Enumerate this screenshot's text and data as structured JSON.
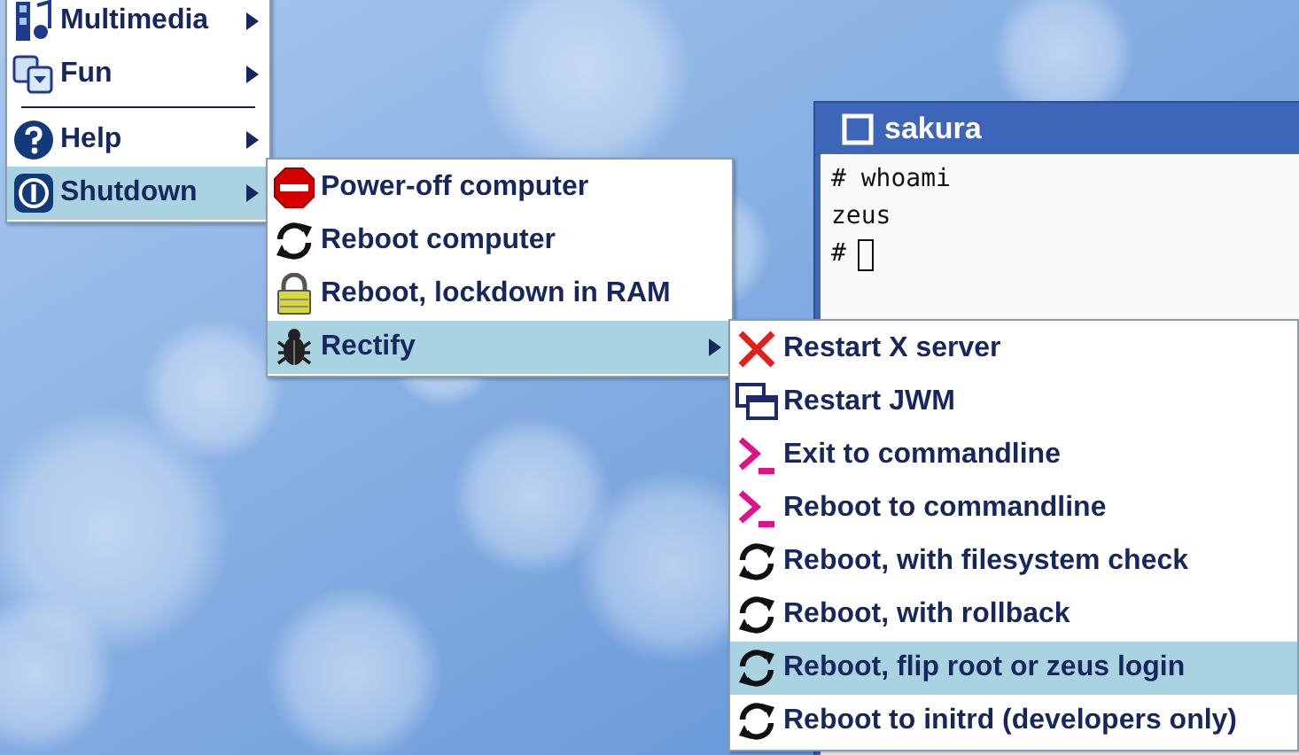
{
  "menus": [
    {
      "items": [
        {
          "kind": "multimedia",
          "label": "Multimedia",
          "has_submenu": true,
          "selected": false
        },
        {
          "kind": "fun",
          "label": "Fun",
          "has_submenu": true,
          "selected": false
        },
        {
          "kind": "separator"
        },
        {
          "kind": "help",
          "label": "Help",
          "has_submenu": true,
          "selected": false
        },
        {
          "kind": "power",
          "label": "Shutdown",
          "has_submenu": true,
          "selected": true
        }
      ]
    },
    {
      "items": [
        {
          "kind": "stop",
          "label": "Power-off computer",
          "has_submenu": false,
          "selected": false
        },
        {
          "kind": "reboot",
          "label": "Reboot computer",
          "has_submenu": false,
          "selected": false
        },
        {
          "kind": "lock",
          "label": "Reboot, lockdown in RAM",
          "has_submenu": false,
          "selected": false
        },
        {
          "kind": "bug",
          "label": "Rectify",
          "has_submenu": true,
          "selected": true
        }
      ]
    },
    {
      "items": [
        {
          "kind": "cross",
          "label": "Restart X server",
          "has_submenu": false,
          "selected": false
        },
        {
          "kind": "windows",
          "label": "Restart JWM",
          "has_submenu": false,
          "selected": false
        },
        {
          "kind": "prompt",
          "label": "Exit to commandline",
          "has_submenu": false,
          "selected": false
        },
        {
          "kind": "prompt",
          "label": "Reboot to commandline",
          "has_submenu": false,
          "selected": false
        },
        {
          "kind": "reboot",
          "label": "Reboot, with filesystem check",
          "has_submenu": false,
          "selected": false
        },
        {
          "kind": "reboot",
          "label": "Reboot, with rollback",
          "has_submenu": false,
          "selected": false
        },
        {
          "kind": "reboot",
          "label": "Reboot, flip root or zeus login",
          "has_submenu": false,
          "selected": true
        },
        {
          "kind": "reboot",
          "label": "Reboot to initrd (developers only)",
          "has_submenu": false,
          "selected": false
        }
      ]
    }
  ],
  "terminal": {
    "title": "sakura",
    "lines": [
      "# whoami",
      "zeus",
      "#"
    ]
  }
}
